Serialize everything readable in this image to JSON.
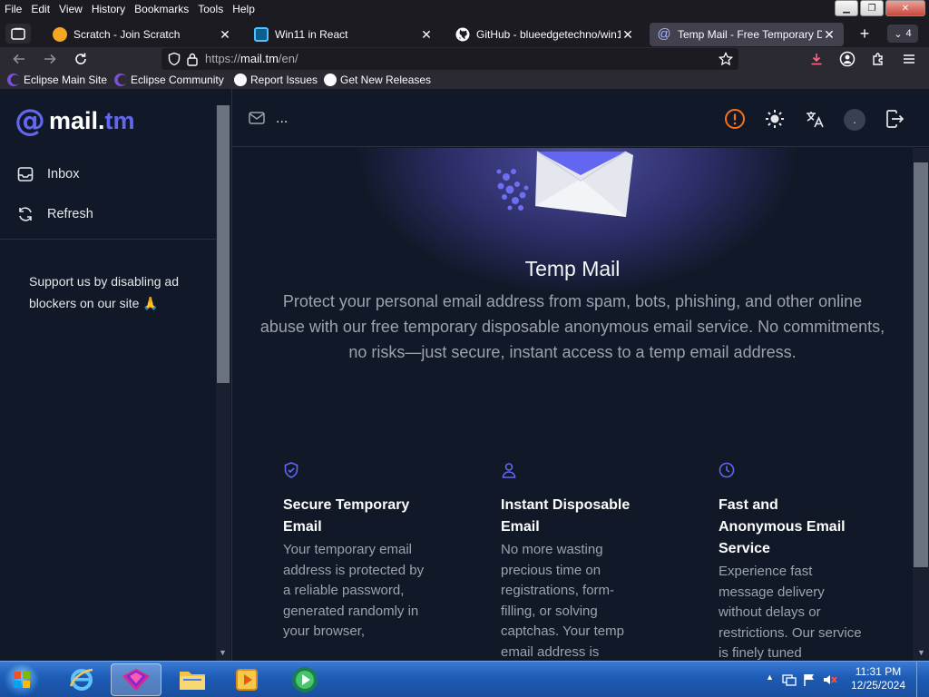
{
  "browser": {
    "menu": [
      "File",
      "Edit",
      "View",
      "History",
      "Bookmarks",
      "Tools",
      "Help"
    ],
    "tabs": [
      {
        "title": "Scratch - Join Scratch",
        "active": false
      },
      {
        "title": "Win11 in React",
        "active": false
      },
      {
        "title": "GitHub - blueedgetechno/win1",
        "active": false
      },
      {
        "title": "Temp Mail - Free Temporary Di",
        "active": true
      }
    ],
    "tab_count": "4",
    "url_scheme": "https://",
    "url_host": "mail.tm",
    "url_path": "/en/",
    "bookmarks": [
      "Eclipse Main Site",
      "Eclipse Community",
      "Report Issues",
      "Get New Releases"
    ]
  },
  "site": {
    "logo_prefix": "mail.",
    "logo_suffix": "tm",
    "sidebar": {
      "items": [
        {
          "label": "Inbox",
          "icon": "inbox-icon"
        },
        {
          "label": "Refresh",
          "icon": "refresh-icon"
        }
      ],
      "support_text": "Support us by disabling ad blockers on our site 🙏"
    },
    "topbar": {
      "address": "..."
    },
    "avatar_initial": ".",
    "hero": {
      "title": "Temp Mail",
      "description": "Protect your personal email address from spam, bots, phishing, and other online abuse with our free temporary disposable anonymous email service. No commitments, no risks—just secure, instant access to a temp email address."
    },
    "features": [
      {
        "icon": "shield-check-icon",
        "title": "Secure Temporary Email",
        "desc": "Your temporary email address is protected by a reliable password, generated randomly in your browser,"
      },
      {
        "icon": "user-icon",
        "title": "Instant Disposable Email",
        "desc": "No more wasting precious time on registrations, form-filling, or solving captchas. Your temp email address is"
      },
      {
        "icon": "clock-icon",
        "title": "Fast and Anonymous Email Service",
        "desc": "Experience fast message delivery without delays or restrictions. Our service is finely tuned"
      }
    ]
  },
  "taskbar": {
    "time": "11:31 PM",
    "date": "12/25/2024"
  },
  "colors": {
    "accent": "#6366f1",
    "warning": "#f97316",
    "page_bg": "#111827"
  }
}
